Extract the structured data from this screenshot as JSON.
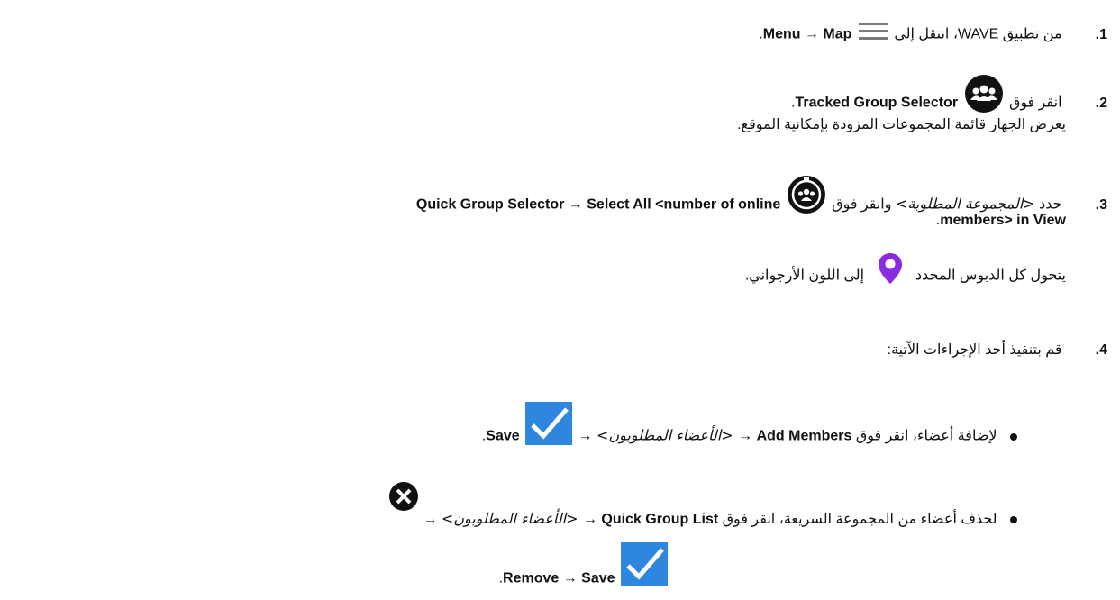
{
  "steps": [
    {
      "number": "1.",
      "text_a": "من تطبيق WAVE، انتقل إلى",
      "menu": "Menu",
      "arrow": "→",
      "map": "Map",
      "end": "."
    },
    {
      "number": "2.",
      "text_a": "انقر فوق",
      "selector": "Tracked Group Selector",
      "end": ".",
      "note": "يعرض الجهاز قائمة المجموعات المزودة بإمكانية الموقع."
    },
    {
      "number": "3.",
      "text_a": "حدد",
      "group_placeholder": "<المجموعة المطلوبة>",
      "text_b": "وانقر فوق",
      "line1_bold": "Quick Group Selector → Select All <number of online",
      "line2_bold": "members> in View",
      "end": ".",
      "note_a": "يتحول كل الدبوس المحدد",
      "note_b": "إلى اللون الأرجواني."
    },
    {
      "number": "4.",
      "text_a": "قم بتنفيذ أحد الإجراءات الآتية:"
    }
  ],
  "bullets": [
    {
      "text_a": "لإضافة أعضاء، انقر فوق",
      "add_members": "Add Members",
      "arrow": "→",
      "members_placeholder": "<الأعضاء المطلوبون>",
      "save": "Save",
      "end": "."
    },
    {
      "text_a": "لحذف أعضاء من المجموعة السريعة، انقر فوق",
      "quick_list": "Quick Group List",
      "arrow": "→",
      "members_placeholder": "<الأعضاء المطلوبون>",
      "remove_line": "Save",
      "remove": "Remove →",
      "end": "."
    }
  ],
  "colors": {
    "pin": "#8a2be2",
    "check": "#2e86de",
    "icon_dark": "#111111"
  }
}
